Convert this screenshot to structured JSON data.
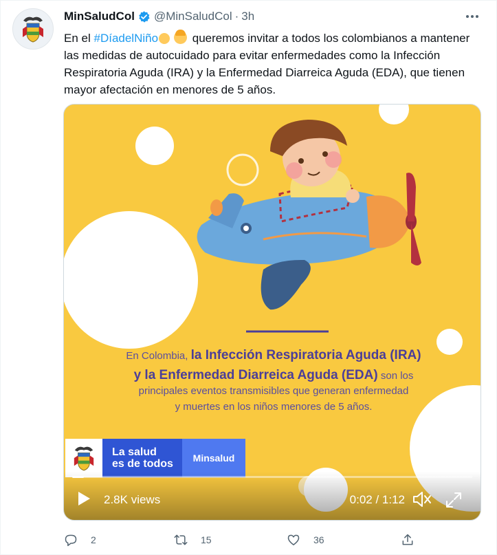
{
  "tweet": {
    "author_name": "MinSaludCol",
    "handle": "@MinSaludCol",
    "separator": "·",
    "time": "3h",
    "text_before": "En el ",
    "hashtag": "#DíadelNiño",
    "text_after": " queremos invitar a todos los colombianos a mantener las medidas de autocuidado para evitar enfermedades como la Infección Respiratoria Aguda (IRA) y la Enfermedad Diarreica Aguda (EDA), que tienen mayor afectación en menores de 5 años."
  },
  "media": {
    "message": {
      "lead": "En Colombia, ",
      "bold1": "la Infección Respiratoria Aguda (IRA)",
      "bold2": "y la Enfermedad Diarreica Aguda (EDA)",
      "tail2": " son los",
      "line3": "principales eventos transmisibles que generan enfermedad",
      "line4": "y muertes en los niños menores de 5 años."
    },
    "brand": {
      "slogan_line1": "La salud",
      "slogan_line2": "es de todos",
      "ministry": "Minsalud"
    },
    "player": {
      "views": "2.8K views",
      "elapsed": "0:02",
      "duration": "1:12",
      "time_separator": " / ",
      "progress": 0.03
    }
  },
  "actions": {
    "replies": "2",
    "retweets": "15",
    "likes": "36"
  },
  "colors": {
    "link": "#1d9bf0",
    "media_bg": "#f9c940",
    "headline_purple": "#4b3e99",
    "slogan_blue": "#2f55d4",
    "ministry_blue": "#4f79f0"
  }
}
